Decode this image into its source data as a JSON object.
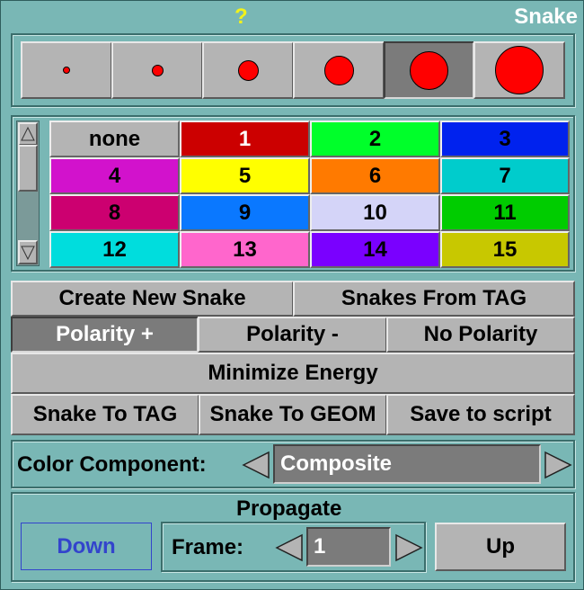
{
  "window": {
    "title": "Snake",
    "help": "?"
  },
  "brush_sizes": {
    "selected_index": 4,
    "sizes": [
      "brush-size-1",
      "brush-size-2",
      "brush-size-3",
      "brush-size-4",
      "brush-size-5",
      "brush-size-6"
    ]
  },
  "labels": {
    "cells": [
      {
        "label": "none",
        "bg": "#b4b4b4",
        "fg": "#000000"
      },
      {
        "label": "1",
        "bg": "#cc0000",
        "fg": "#ffffff"
      },
      {
        "label": "2",
        "bg": "#00ff2a",
        "fg": "#000000"
      },
      {
        "label": "3",
        "bg": "#0022ee",
        "fg": "#000000"
      },
      {
        "label": "4",
        "bg": "#d212cc",
        "fg": "#000000"
      },
      {
        "label": "5",
        "bg": "#ffff00",
        "fg": "#000000"
      },
      {
        "label": "6",
        "bg": "#ff7a00",
        "fg": "#000000"
      },
      {
        "label": "7",
        "bg": "#00cccc",
        "fg": "#000000"
      },
      {
        "label": "8",
        "bg": "#cc0070",
        "fg": "#000000"
      },
      {
        "label": "9",
        "bg": "#0a78ff",
        "fg": "#000000"
      },
      {
        "label": "10",
        "bg": "#d4d4f8",
        "fg": "#000000"
      },
      {
        "label": "11",
        "bg": "#00cc00",
        "fg": "#000000"
      },
      {
        "label": "12",
        "bg": "#00dddd",
        "fg": "#000000"
      },
      {
        "label": "13",
        "bg": "#ff66cc",
        "fg": "#000000"
      },
      {
        "label": "14",
        "bg": "#7a00ff",
        "fg": "#000000"
      },
      {
        "label": "15",
        "bg": "#c8c800",
        "fg": "#000000"
      }
    ]
  },
  "buttons": {
    "create_new_snake": "Create New Snake",
    "snakes_from_tag": "Snakes From TAG",
    "polarity_plus": "Polarity +",
    "polarity_minus": "Polarity -",
    "no_polarity": "No Polarity",
    "minimize_energy": "Minimize Energy",
    "snake_to_tag": "Snake To TAG",
    "snake_to_geom": "Snake To GEOM",
    "save_to_script": "Save to script"
  },
  "color_component": {
    "label": "Color Component:",
    "value": "Composite"
  },
  "propagate": {
    "title": "Propagate",
    "down_label": "Down",
    "frame_label": "Frame:",
    "frame_value": "1",
    "up_label": "Up"
  }
}
